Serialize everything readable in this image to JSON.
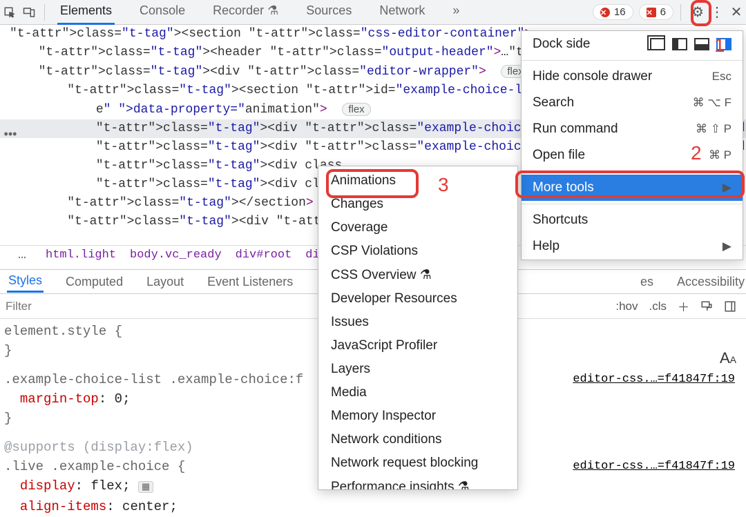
{
  "topbar": {
    "tabs": [
      "Elements",
      "Console",
      "Recorder",
      "Sources",
      "Network"
    ],
    "active_tab_index": 0,
    "errors_count": "16",
    "errors2_count": "6"
  },
  "dom": {
    "lines": [
      {
        "indent": 260,
        "tri": "▼",
        "html": "<section class=\"css-editor-container\">"
      },
      {
        "indent": 280,
        "tri": "▶",
        "html": "<header class=\"output-header\">…</head"
      },
      {
        "indent": 280,
        "tri": "▼",
        "html": "<div class=\"editor-wrapper\"> ",
        "flex": true
      },
      {
        "indent": 300,
        "tri": "▼",
        "html": "<section id=\"example-choice-list\" cl"
      },
      {
        "indent": 320,
        "tri": "",
        "html": "e\" data-property=\"animation\"> ",
        "flex": true
      },
      {
        "indent": 320,
        "tri": "▶",
        "html": "<div class=\"example-choice\">…</div",
        "sel": true
      },
      {
        "indent": 320,
        "tri": "▶",
        "html": "<div class=\"example-choice\">…</div"
      },
      {
        "indent": 320,
        "tri": "▶",
        "html": "<div class"
      },
      {
        "indent": 320,
        "tri": "▶",
        "html": "<div class"
      },
      {
        "indent": 300,
        "tri": "",
        "html": "</section>"
      },
      {
        "indent": 300,
        "tri": "▶",
        "html": "<div id=\"ou"
      }
    ]
  },
  "breadcrumb": [
    "html.light",
    "body.vc_ready",
    "div#root",
    "div.p"
  ],
  "styleTabs": [
    "Styles",
    "Computed",
    "Layout",
    "Event Listeners",
    "es",
    "Accessibility"
  ],
  "styleActive": 0,
  "filterPlaceholder": "Filter",
  "sidebarBits": {
    "hov": ":hov",
    "cls": ".cls"
  },
  "rules": {
    "r1_sel": "element.style {",
    "r1_close": "}",
    "r2_sel": ".example-choice-list .example-choice:f",
    "r2_prop": "margin-top",
    "r2_val": "0",
    "r3_supports": "@supports (display:flex)",
    "r3_sel": ".live .example-choice {",
    "r3_p1": "display",
    "r3_v1": "flex",
    "r3_p2": "align-items",
    "r3_v2": "center",
    "srclink": "editor-css.…=f41847f:19"
  },
  "mainmenu": {
    "dock_label": "Dock side",
    "items": [
      {
        "label": "Hide console drawer",
        "short": "Esc"
      },
      {
        "label": "Search",
        "short": "⌘ ⌥ F"
      },
      {
        "label": "Run command",
        "short": "⌘ ⇧ P"
      },
      {
        "label": "Open file",
        "short": "⌘ P"
      },
      {
        "label": "More tools",
        "short": "▶",
        "hl": true
      },
      {
        "label": "Shortcuts",
        "short": ""
      },
      {
        "label": "Help",
        "short": "▶"
      }
    ]
  },
  "submenu": [
    "Animations",
    "Changes",
    "Coverage",
    "CSP Violations",
    "CSS Overview",
    "Developer Resources",
    "Issues",
    "JavaScript Profiler",
    "Layers",
    "Media",
    "Memory Inspector",
    "Network conditions",
    "Network request blocking",
    "Performance insights"
  ],
  "annotations": {
    "n1": "1",
    "n2": "2",
    "n3": "3"
  }
}
